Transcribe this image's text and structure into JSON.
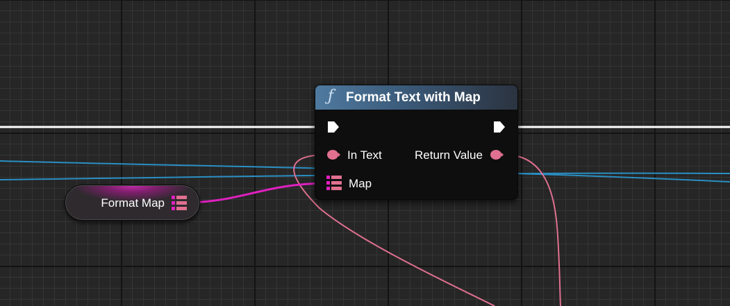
{
  "graph": {
    "colors": {
      "background": "#262626",
      "exec_wire": "#ffffff",
      "text_wire": "#e07090",
      "map_wire": "#e020c0",
      "blue_wire": "#2a8fc4"
    }
  },
  "var_node": {
    "label": "Format Map",
    "icon": "map-icon"
  },
  "function_node": {
    "icon": "ƒ",
    "title": "Format Text with Map",
    "pins": {
      "exec_in": "exec-in-pin-icon",
      "exec_out": "exec-out-pin-icon",
      "in_text": "In Text",
      "return_value": "Return Value",
      "map": "Map"
    }
  }
}
